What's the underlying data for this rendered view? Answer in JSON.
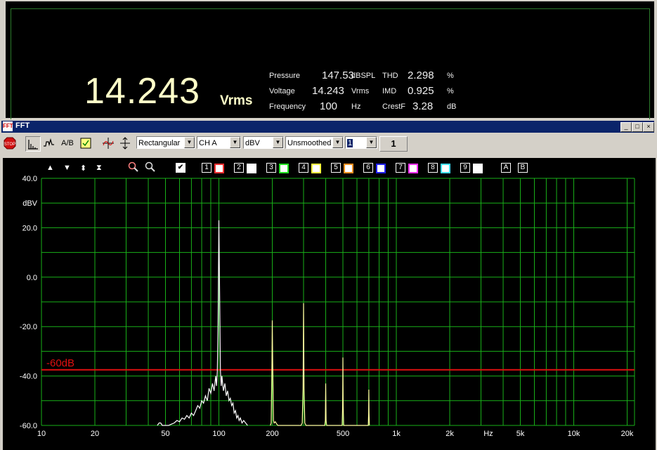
{
  "meter": {
    "main_value": "14.243",
    "main_unit": "Vrms",
    "rows": [
      {
        "label": "Pressure",
        "value": "147.53",
        "unit": "dBSPL",
        "label2": "THD",
        "value2": "2.298",
        "unit2": "%"
      },
      {
        "label": "Voltage",
        "value": "14.243",
        "unit": "Vrms",
        "label2": "IMD",
        "value2": "0.925",
        "unit2": "%"
      },
      {
        "label": "Frequency",
        "value": "100",
        "unit": "Hz",
        "label2": "CrestF",
        "value2": "3.28",
        "unit2": "dB"
      }
    ]
  },
  "window": {
    "title": "FFT",
    "icon_text": "FFT"
  },
  "toolbar": {
    "stop_label": "STOP",
    "ab_label": "A/B",
    "window_fn": "Rectangular",
    "channel": "CH A",
    "unit": "dBV",
    "smoothing": "Unsmoothed",
    "averages_select": "1",
    "averages_count": "1"
  },
  "traces": {
    "check_mark": "✔",
    "items": [
      {
        "label": "1",
        "color": "#ff3030"
      },
      {
        "label": "2",
        "color": "#ffffff"
      },
      {
        "label": "3",
        "color": "#20e020"
      },
      {
        "label": "4",
        "color": "#ffff40"
      },
      {
        "label": "5",
        "color": "#ff9020"
      },
      {
        "label": "6",
        "color": "#2020ff"
      },
      {
        "label": "7",
        "color": "#ff30ff"
      },
      {
        "label": "8",
        "color": "#40e0ff"
      },
      {
        "label": "9",
        "color": "#ffffff"
      }
    ],
    "ref_a": "A",
    "ref_b": "B"
  },
  "colors": {
    "grid": "#19b019",
    "trace_main": "#ffffff",
    "trace_harm": "#ffffa0",
    "marker_line": "#e01010",
    "axis_text": "#ffffff"
  },
  "chart_data": {
    "type": "line",
    "xlabel": "Hz",
    "ylabel": "dBV",
    "xscale": "log",
    "xlim": [
      10,
      22000
    ],
    "ylim": [
      -60,
      40
    ],
    "x_ticks": [
      {
        "v": 10,
        "t": "10"
      },
      {
        "v": 20,
        "t": "20"
      },
      {
        "v": 50,
        "t": "50"
      },
      {
        "v": 100,
        "t": "100"
      },
      {
        "v": 200,
        "t": "200"
      },
      {
        "v": 500,
        "t": "500"
      },
      {
        "v": 1000,
        "t": "1k"
      },
      {
        "v": 2000,
        "t": "2k"
      },
      {
        "v": 5000,
        "t": "5k"
      },
      {
        "v": 10000,
        "t": "10k"
      },
      {
        "v": 20000,
        "t": "20k"
      }
    ],
    "y_ticks": [
      {
        "v": 40,
        "t": "40.0"
      },
      {
        "v": 20,
        "t": "20.0"
      },
      {
        "v": 0,
        "t": "0.0"
      },
      {
        "v": -20,
        "t": "-20.0"
      },
      {
        "v": -40,
        "t": "-40.0"
      },
      {
        "v": -60,
        "t": "-60.0"
      }
    ],
    "marker": {
      "label": "-60dB",
      "y": -37.5
    },
    "series": [
      {
        "color": "#ffffff",
        "x": [
          45,
          46,
          47,
          48,
          52,
          54,
          56,
          58,
          60,
          62,
          64,
          66,
          68,
          70,
          72,
          74,
          76,
          78,
          80,
          82,
          84,
          86,
          88,
          90,
          92,
          94,
          96,
          97,
          98,
          99,
          100,
          101,
          102,
          103,
          104,
          106,
          108,
          110,
          112,
          114,
          116,
          118,
          120,
          122,
          124,
          126,
          128,
          130,
          132,
          135,
          138,
          145
        ],
        "y": [
          -60,
          -59,
          -59,
          -60,
          -60,
          -59.5,
          -59,
          -58,
          -58.5,
          -57,
          -57.5,
          -56,
          -57,
          -55,
          -56,
          -54,
          -52,
          -53,
          -50,
          -51,
          -48,
          -50,
          -45,
          -47,
          -43,
          -46,
          -40,
          -44,
          -38,
          -18,
          23,
          -8,
          -38,
          -44,
          -40,
          -46,
          -43,
          -48,
          -46,
          -50,
          -49,
          -52,
          -51,
          -55,
          -54,
          -57,
          -56,
          -58,
          -57,
          -59,
          -58,
          -60
        ]
      },
      {
        "color": "#ffffa0",
        "x": [
          195,
          197,
          199,
          200,
          201,
          203,
          205,
          208,
          212,
          215,
          290,
          295,
          298,
          300,
          302,
          305,
          310,
          395,
          398,
          400,
          402,
          405,
          495,
          498,
          500,
          502,
          505,
          695,
          698,
          700,
          702,
          705
        ],
        "y": [
          -60,
          -59,
          -35,
          -17.5,
          -35,
          -58,
          -59,
          -58.5,
          -59.5,
          -60,
          -60,
          -59,
          -45,
          -10.5,
          -45,
          -59,
          -60,
          -60,
          -58,
          -43,
          -58,
          -60,
          -60,
          -52,
          -32.5,
          -52,
          -60,
          -60,
          -55,
          -45.5,
          -55,
          -60
        ]
      }
    ]
  }
}
